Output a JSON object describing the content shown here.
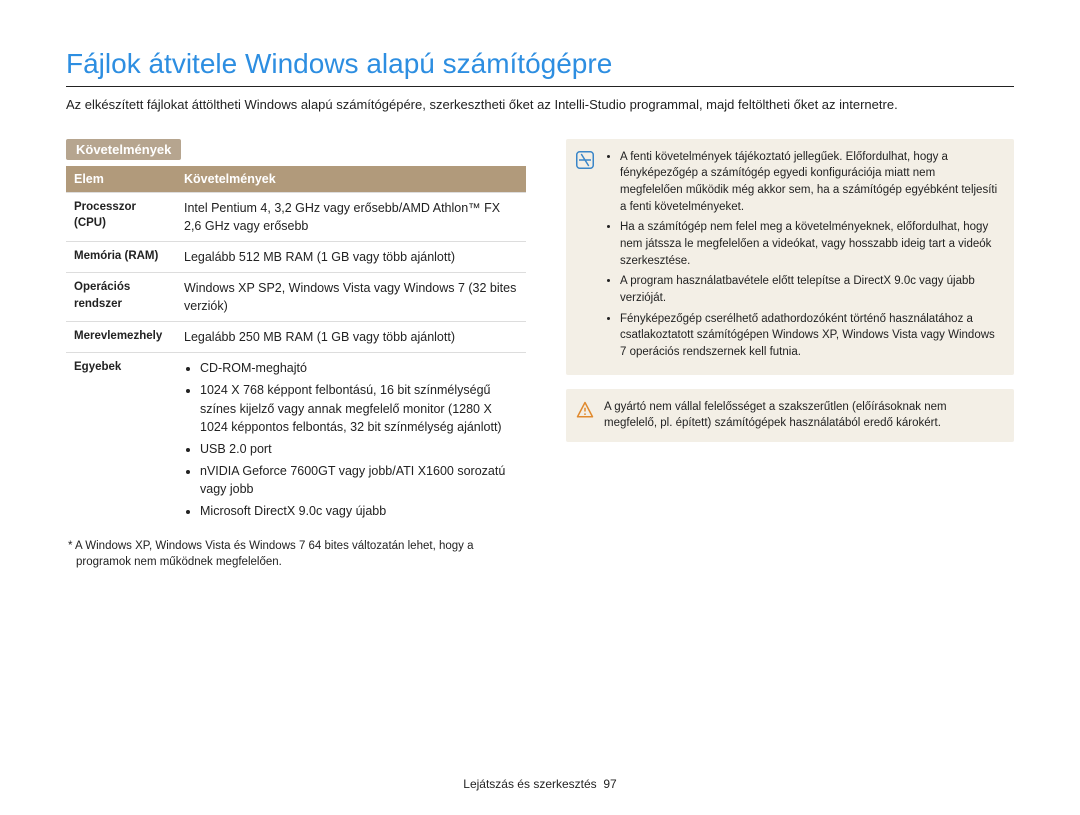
{
  "title": "Fájlok átvitele Windows alapú számítógépre",
  "intro": "Az elkészített fájlokat áttöltheti Windows alapú számítógépére, szerkesztheti őket az Intelli-Studio programmal, majd feltöltheti őket az internetre.",
  "section_tag": "Követelmények",
  "table": {
    "head_item": "Elem",
    "head_req": "Követelmények",
    "rows": {
      "cpu_label": "Processzor (CPU)",
      "cpu_value": "Intel Pentium 4, 3,2 GHz vagy erősebb/AMD Athlon™ FX 2,6 GHz vagy erősebb",
      "ram_label": "Memória (RAM)",
      "ram_value": "Legalább 512 MB RAM (1 GB vagy több ajánlott)",
      "os_label": "Operációs rendszer",
      "os_value": "Windows XP SP2, Windows Vista vagy Windows 7 (32 bites verziók)",
      "hdd_label": "Merevlemezhely",
      "hdd_value": "Legalább 250 MB RAM (1 GB vagy több ajánlott)",
      "others_label": "Egyebek",
      "others_items": {
        "0": "CD-ROM-meghajtó",
        "1": "1024 X 768 képpont felbontású, 16 bit színmélységű színes kijelző vagy annak megfelelő monitor (1280 X 1024 képpontos felbontás, 32 bit színmélység ajánlott)",
        "2": "USB 2.0 port",
        "3": "nVIDIA Geforce 7600GT vagy jobb/ATI X1600 sorozatú vagy jobb",
        "4": "Microsoft DirectX 9.0c vagy újabb"
      }
    }
  },
  "footnote": "* A Windows XP, Windows Vista és Windows 7 64 bites változatán lehet, hogy a programok nem működnek megfelelően.",
  "info_box": {
    "items": {
      "0": "A fenti követelmények tájékoztató jellegűek. Előfordulhat, hogy a fényképezőgép a számítógép egyedi konfigurációja miatt nem megfelelően működik még akkor sem, ha a számítógép egyébként teljesíti a fenti követelményeket.",
      "1": "Ha a számítógép nem felel meg a követelményeknek, előfordulhat, hogy nem játssza le megfelelően a videókat, vagy hosszabb ideig tart a videók szerkesztése.",
      "2": "A program használatbavétele előtt telepítse a DirectX 9.0c vagy újabb verzióját.",
      "3": "Fényképezőgép cserélhető adathordozóként történő használatához a csatlakoztatott számítógépen Windows XP, Windows Vista vagy Windows 7 operációs rendszernek kell futnia."
    }
  },
  "warning_box": {
    "text": "A gyártó nem vállal felelősséget a szakszerűtlen (előírásoknak nem megfelelő, pl. épített) számítógépek használatából eredő károkért."
  },
  "footer": {
    "section": "Lejátszás és szerkesztés",
    "page": "97"
  }
}
